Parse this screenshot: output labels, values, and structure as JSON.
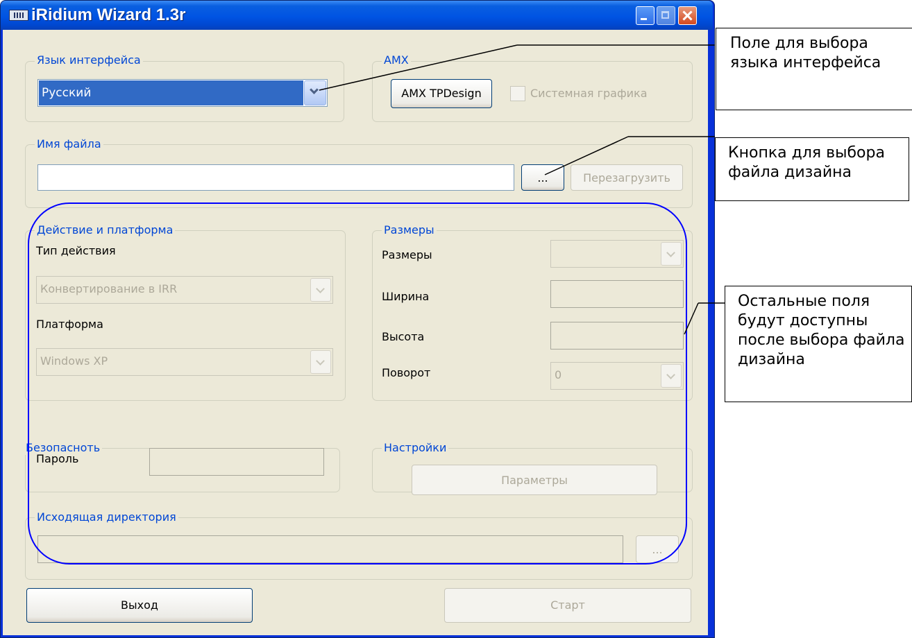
{
  "window": {
    "title": "iRidium Wizard 1.3r"
  },
  "language": {
    "legend": "Язык интерфейса",
    "selected": "Русский"
  },
  "amx": {
    "legend": "AMX",
    "tpdesign_button": "AMX TPDesign",
    "system_graphics_label": "Системная графика"
  },
  "file": {
    "legend": "Имя файла",
    "value": "",
    "browse_button": "...",
    "reload_button": "Перезагрузить"
  },
  "action_platform": {
    "legend": "Действие и платформа",
    "action_type_label": "Тип действия",
    "action_type_value": "Конвертирование в IRR",
    "platform_label": "Платформа",
    "platform_value": "Windows XP"
  },
  "sizes": {
    "legend": "Размеры",
    "sizes_label": "Размеры",
    "width_label": "Ширина",
    "height_label": "Высота",
    "rotation_label": "Поворот",
    "rotation_value": "0"
  },
  "security": {
    "legend": "Безопасноть",
    "password_label": "Пароль"
  },
  "settings": {
    "legend": "Настройки",
    "params_button": "Параметры"
  },
  "output": {
    "legend": "Исходящая директория",
    "browse_button": "..."
  },
  "footer": {
    "exit_button": "Выход",
    "start_button": "Старт"
  },
  "annotations": {
    "language_note": "Поле для выбора языка интерфейса",
    "file_button_note": "Кнопка для выбора файла дизайна",
    "other_fields_note": "Остальные поля будут доступны после выбора файла дизайна"
  },
  "colors": {
    "highlight": "#316ac5",
    "legend_text": "#0046d5",
    "annotation_oval": "#0000ff",
    "face": "#ece9d8"
  }
}
